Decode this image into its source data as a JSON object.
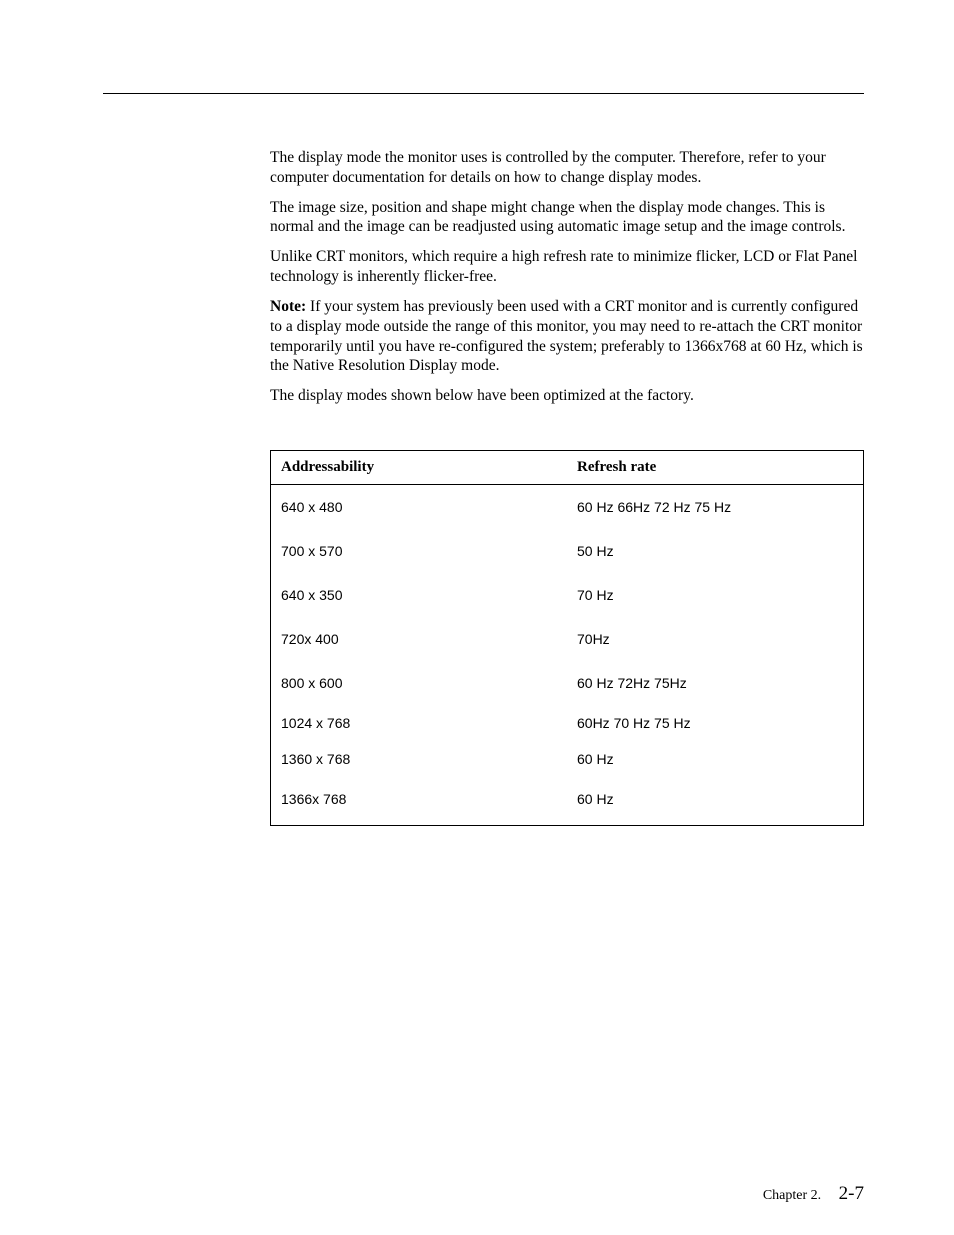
{
  "paragraphs": {
    "p1": "The display mode the monitor uses is controlled by the computer. Therefore, refer to your computer documentation for details on how to change display modes.",
    "p2": "The image size, position and shape might change when the display mode changes. This is normal and the image can be readjusted using automatic image setup and the image controls.",
    "p3": "Unlike CRT monitors, which require a high refresh rate to minimize flicker, LCD or Flat Panel technology is inherently flicker-free.",
    "note_label": "Note:",
    "p4": "  If your system has previously been used with a CRT monitor and is currently configured to a display mode outside the range of this monitor, you may need to re-attach the CRT monitor temporarily until you have re-configured the system; preferably to 1366x768 at 60 Hz, which is the Native Resolution Display mode.",
    "p5": "The display modes shown below have been optimized at the factory."
  },
  "table": {
    "header": {
      "addressability": "Addressability",
      "refresh_rate": "Refresh rate"
    },
    "rows": [
      {
        "addr": "640 x 480",
        "rate": "60 Hz   66Hz  72 Hz   75 Hz"
      },
      {
        "addr": "700 x 570",
        "rate": "50 Hz"
      },
      {
        "addr": "640 x 350",
        "rate": "70 Hz"
      },
      {
        "addr": "720x 400",
        "rate": "70Hz"
      },
      {
        "addr": "800 x 600",
        "rate": "60 Hz  72Hz  75Hz"
      },
      {
        "addr": "1024  x 768",
        "rate": "60Hz   70 Hz  75 Hz"
      },
      {
        "addr": "1360  x 768",
        "rate": "60 Hz"
      },
      {
        "addr": "1366x 768",
        "rate": "60 Hz"
      }
    ]
  },
  "footer": {
    "chapter": "Chapter 2.",
    "page": "2-7"
  }
}
